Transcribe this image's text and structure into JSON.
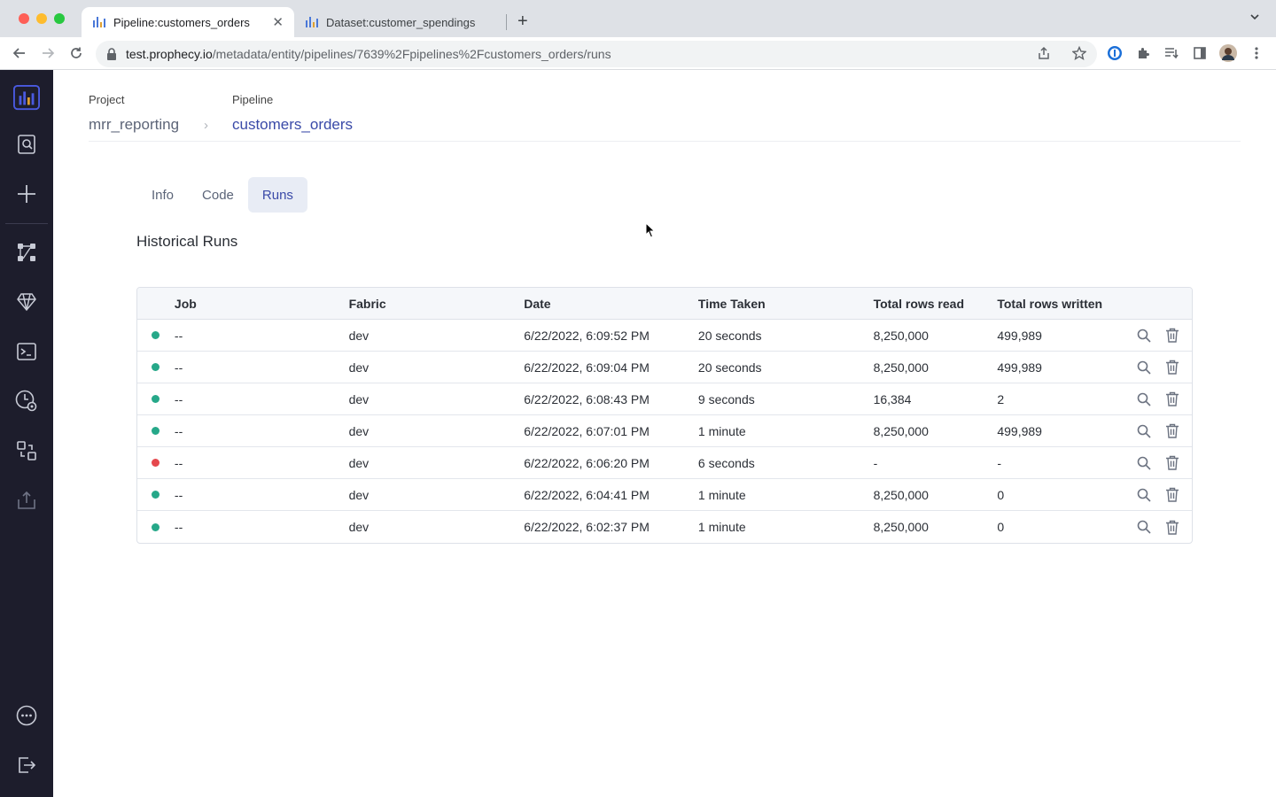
{
  "browser": {
    "tabs": [
      {
        "title": "Pipeline:customers_orders",
        "active": true
      },
      {
        "title": "Dataset:customer_spendings",
        "active": false
      }
    ],
    "url_host": "test.prophecy.io",
    "url_path": "/metadata/entity/pipelines/7639%2Fpipelines%2Fcustomers_orders/runs",
    "icons": [
      "back-icon",
      "forward-icon",
      "reload-icon",
      "share-icon",
      "bookmark-star-icon",
      "password-manager-icon",
      "extensions-icon",
      "reading-list-icon",
      "side-panel-icon",
      "profile-avatar",
      "menu-icon"
    ]
  },
  "sidebar": {
    "items": [
      "logo-icon",
      "search-metadata-icon",
      "create-icon",
      "pipelines-icon",
      "gems-icon",
      "ide-terminal-icon",
      "job-scheduler-icon",
      "transpiler-icon",
      "upload-icon",
      "more-icon",
      "logout-icon"
    ]
  },
  "breadcrumb": {
    "project_label": "Project",
    "project_value": "mrr_reporting",
    "separator": "›",
    "pipeline_label": "Pipeline",
    "pipeline_value": "customers_orders"
  },
  "tabs": [
    {
      "label": "Info",
      "selected": false
    },
    {
      "label": "Code",
      "selected": false
    },
    {
      "label": "Runs",
      "selected": true
    }
  ],
  "section_title": "Historical Runs",
  "table": {
    "columns": [
      "",
      "Job",
      "Fabric",
      "Date",
      "Time Taken",
      "Total rows read",
      "Total rows written",
      ""
    ],
    "rows": [
      {
        "status": "success",
        "job": "--",
        "fabric": "dev",
        "date": "6/22/2022, 6:09:52 PM",
        "time": "20 seconds",
        "read": "8,250,000",
        "written": "499,989"
      },
      {
        "status": "success",
        "job": "--",
        "fabric": "dev",
        "date": "6/22/2022, 6:09:04 PM",
        "time": "20 seconds",
        "read": "8,250,000",
        "written": "499,989"
      },
      {
        "status": "success",
        "job": "--",
        "fabric": "dev",
        "date": "6/22/2022, 6:08:43 PM",
        "time": "9 seconds",
        "read": "16,384",
        "written": "2"
      },
      {
        "status": "success",
        "job": "--",
        "fabric": "dev",
        "date": "6/22/2022, 6:07:01 PM",
        "time": "1 minute",
        "read": "8,250,000",
        "written": "499,989"
      },
      {
        "status": "failed",
        "job": "--",
        "fabric": "dev",
        "date": "6/22/2022, 6:06:20 PM",
        "time": "6 seconds",
        "read": "-",
        "written": "-"
      },
      {
        "status": "success",
        "job": "--",
        "fabric": "dev",
        "date": "6/22/2022, 6:04:41 PM",
        "time": "1 minute",
        "read": "8,250,000",
        "written": "0"
      },
      {
        "status": "success",
        "job": "--",
        "fabric": "dev",
        "date": "6/22/2022, 6:02:37 PM",
        "time": "1 minute",
        "read": "8,250,000",
        "written": "0"
      }
    ]
  },
  "colors": {
    "success": "#26a889",
    "failed": "#e5484d",
    "accent": "#3a4aa8",
    "sidebar_bg": "#1d1d2c"
  }
}
